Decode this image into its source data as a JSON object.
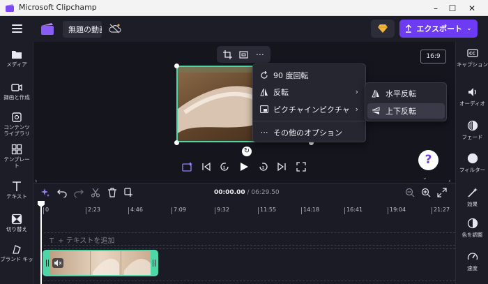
{
  "window": {
    "title": "Microsoft Clipchamp",
    "minimize": "–",
    "maximize": "☐",
    "close": "✕"
  },
  "topbar": {
    "project_name": "無題の動画",
    "export_label": "エクスポート"
  },
  "left_nav": [
    {
      "label": "メディア",
      "icon": "folder-icon"
    },
    {
      "label": "録画と作成",
      "icon": "camera-icon"
    },
    {
      "label": "コンテンツ",
      "label2": "ライブラリ",
      "icon": "content-library-icon"
    },
    {
      "label": "テンプレー",
      "label2": "ト",
      "icon": "templates-icon"
    },
    {
      "label": "テキスト",
      "icon": "text-icon"
    },
    {
      "label": "切り替え",
      "icon": "transitions-icon"
    },
    {
      "label": "ブランド キッ",
      "icon": "brand-kit-icon"
    }
  ],
  "right_nav": [
    {
      "label": "キャプション",
      "icon": "captions-icon"
    },
    {
      "label": "オーディオ",
      "icon": "audio-icon"
    },
    {
      "label": "フェード",
      "icon": "fade-icon"
    },
    {
      "label": "フィルター",
      "icon": "filters-icon"
    },
    {
      "label": "効果",
      "icon": "effects-icon"
    },
    {
      "label": "色を調整",
      "icon": "adjust-colors-icon"
    },
    {
      "label": "速度",
      "icon": "speed-icon"
    }
  ],
  "stage": {
    "aspect_ratio": "16:9",
    "help": "?"
  },
  "context_menu": {
    "items": [
      {
        "label": "90 度回転",
        "icon": "rotate-icon"
      },
      {
        "label": "反転",
        "icon": "flip-icon",
        "has_submenu": true
      },
      {
        "label": "ピクチャインピクチャ",
        "icon": "pip-icon",
        "has_submenu": true
      },
      {
        "label": "その他のオプション",
        "icon": "more-icon"
      }
    ],
    "submenu": [
      {
        "label": "水平反転",
        "icon": "flip-horizontal-icon"
      },
      {
        "label": "上下反転",
        "icon": "flip-vertical-icon",
        "active": true
      }
    ]
  },
  "timeline": {
    "current_time": "00:00.00",
    "separator": " / ",
    "total_time": "06:29.50",
    "ruler_labels": [
      "0",
      "2:23",
      "4:46",
      "7:09",
      "9:32",
      "11:55",
      "14:18",
      "16:41",
      "19:04",
      "21:27"
    ],
    "add_text_label": "+ テキストを追加"
  },
  "colors": {
    "accent": "#6d3bf2",
    "selection": "#4fd6a6",
    "background": "#1d1d28"
  }
}
